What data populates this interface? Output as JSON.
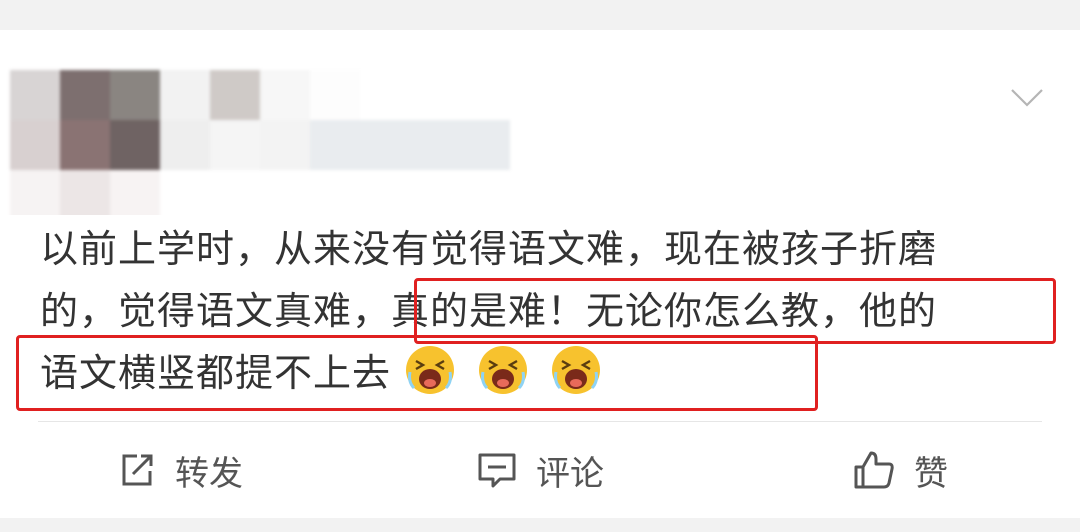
{
  "post": {
    "text_lines": [
      "以前上学时，从来没有觉得语文难，现在被孩子折磨",
      "的，觉得语文真难，真的是难！无论你怎么教，他的",
      "语文横竖都提不上去"
    ],
    "emoji": [
      "crying-emoji",
      "crying-emoji",
      "crying-emoji"
    ]
  },
  "actions": {
    "repost_label": "转发",
    "comment_label": "评论",
    "like_label": "赞"
  },
  "icons": {
    "menu": "chevron-down-icon",
    "repost": "repost-icon",
    "comment": "comment-icon",
    "like": "thumbs-up-icon"
  },
  "colors": {
    "highlight": "#e02020",
    "text": "#333333",
    "icon": "#555555"
  }
}
